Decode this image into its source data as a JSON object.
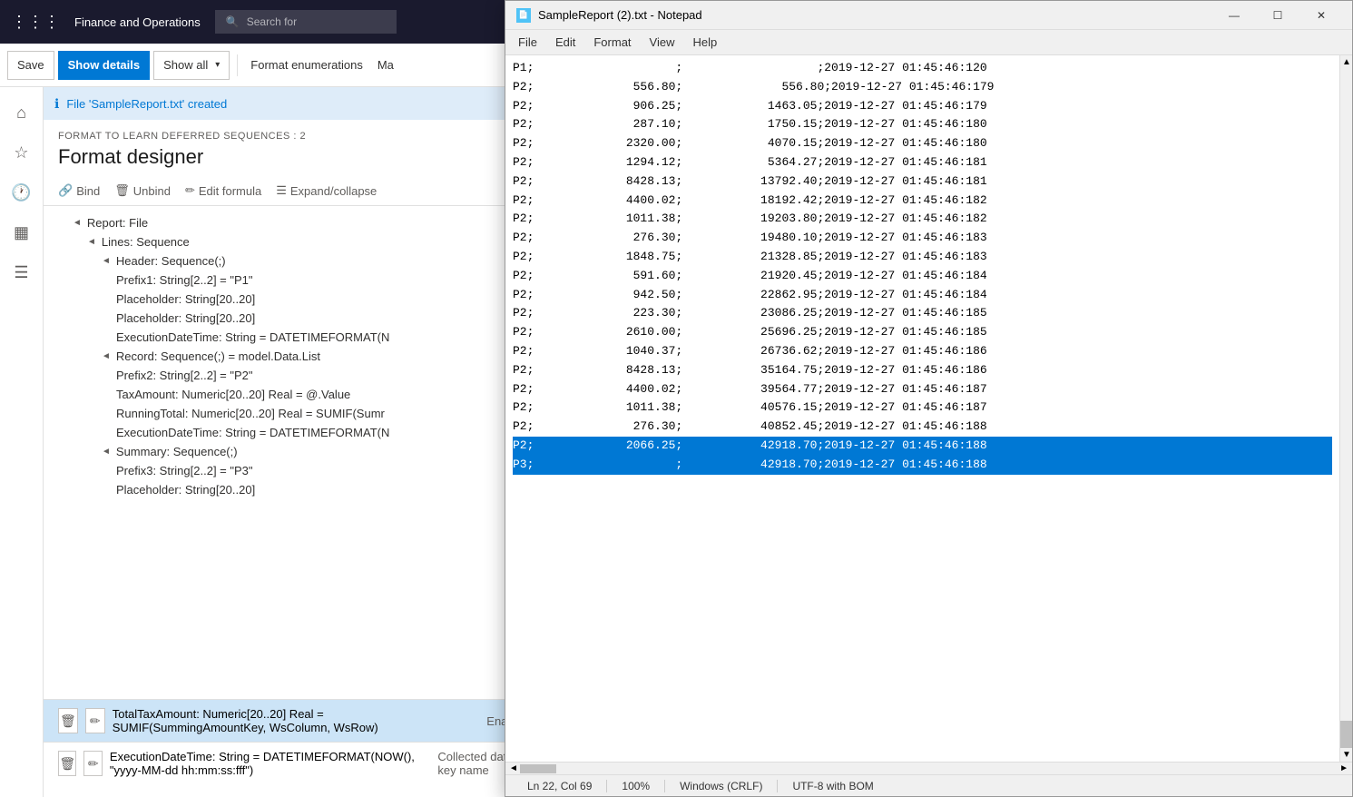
{
  "app": {
    "title": "Finance and Operations",
    "search_placeholder": "Search for"
  },
  "toolbar": {
    "save_label": "Save",
    "show_details_label": "Show details",
    "show_all_label": "Show all",
    "format_enum_label": "Format enumerations",
    "ma_label": "Ma"
  },
  "info_bar": {
    "message": "File 'SampleReport.txt' created"
  },
  "designer": {
    "subtitle": "FORMAT TO LEARN DEFERRED SEQUENCES : 2",
    "title": "Format designer",
    "tools": {
      "bind": "Bind",
      "unbind": "Unbind",
      "edit_formula": "Edit formula",
      "expand_collapse": "Expand/collapse"
    }
  },
  "tree": {
    "items": [
      {
        "label": "Report: File",
        "level": 0,
        "arrow": "◄",
        "indent": "indent1"
      },
      {
        "label": "Lines: Sequence",
        "level": 1,
        "arrow": "◄",
        "indent": "indent2"
      },
      {
        "label": "Header: Sequence(;)",
        "level": 2,
        "arrow": "◄",
        "indent": "indent3"
      },
      {
        "label": "Prefix1: String[2..2] = \"P1\"",
        "level": 3,
        "arrow": "",
        "indent": "indent4"
      },
      {
        "label": "Placeholder: String[20..20]",
        "level": 3,
        "arrow": "",
        "indent": "indent4"
      },
      {
        "label": "Placeholder: String[20..20]",
        "level": 3,
        "arrow": "",
        "indent": "indent4"
      },
      {
        "label": "ExecutionDateTime: String = DATETIMEFORMAT(N",
        "level": 3,
        "arrow": "",
        "indent": "indent4"
      },
      {
        "label": "Record: Sequence(;) = model.Data.List",
        "level": 2,
        "arrow": "◄",
        "indent": "indent3"
      },
      {
        "label": "Prefix2: String[2..2] = \"P2\"",
        "level": 3,
        "arrow": "",
        "indent": "indent4"
      },
      {
        "label": "TaxAmount: Numeric[20..20] Real = @.Value",
        "level": 3,
        "arrow": "",
        "indent": "indent4"
      },
      {
        "label": "RunningTotal: Numeric[20..20] Real = SUMIF(Sumr",
        "level": 3,
        "arrow": "",
        "indent": "indent4"
      },
      {
        "label": "ExecutionDateTime: String = DATETIMEFORMAT(N",
        "level": 3,
        "arrow": "",
        "indent": "indent4"
      },
      {
        "label": "Summary: Sequence(;)",
        "level": 2,
        "arrow": "◄",
        "indent": "indent3"
      },
      {
        "label": "Prefix3: String[2..2] = \"P3\"",
        "level": 3,
        "arrow": "",
        "indent": "indent4"
      },
      {
        "label": "Placeholder: String[20..20]",
        "level": 3,
        "arrow": "",
        "indent": "indent4"
      }
    ]
  },
  "bottom_rows": [
    {
      "label": "TotalTaxAmount: Numeric[20..20] Real = SUMIF(SummingAmountKey, WsColumn, WsRow)",
      "selected": true
    },
    {
      "label": "ExecutionDateTime: String = DATETIMEFORMAT(NOW(), \"yyyy-MM-dd hh:mm:ss:fff\")",
      "selected": false
    }
  ],
  "right_props": [
    {
      "label": "Enabled"
    },
    {
      "label": "Collected data key name"
    }
  ],
  "notepad": {
    "title": "SampleReport (2).txt - Notepad",
    "menu_items": [
      "File",
      "Edit",
      "Format",
      "View",
      "Help"
    ],
    "lines": [
      {
        "text": "P1;                    ;                   ;2019-12-27 01:45:46:120",
        "highlight": false
      },
      {
        "text": "P2;              556.80;              556.80;2019-12-27 01:45:46:179",
        "highlight": false
      },
      {
        "text": "P2;              906.25;            1463.05;2019-12-27 01:45:46:179",
        "highlight": false
      },
      {
        "text": "P2;              287.10;            1750.15;2019-12-27 01:45:46:180",
        "highlight": false
      },
      {
        "text": "P2;             2320.00;            4070.15;2019-12-27 01:45:46:180",
        "highlight": false
      },
      {
        "text": "P2;             1294.12;            5364.27;2019-12-27 01:45:46:181",
        "highlight": false
      },
      {
        "text": "P2;             8428.13;           13792.40;2019-12-27 01:45:46:181",
        "highlight": false
      },
      {
        "text": "P2;             4400.02;           18192.42;2019-12-27 01:45:46:182",
        "highlight": false
      },
      {
        "text": "P2;             1011.38;           19203.80;2019-12-27 01:45:46:182",
        "highlight": false
      },
      {
        "text": "P2;              276.30;           19480.10;2019-12-27 01:45:46:183",
        "highlight": false
      },
      {
        "text": "P2;             1848.75;           21328.85;2019-12-27 01:45:46:183",
        "highlight": false
      },
      {
        "text": "P2;              591.60;           21920.45;2019-12-27 01:45:46:184",
        "highlight": false
      },
      {
        "text": "P2;              942.50;           22862.95;2019-12-27 01:45:46:184",
        "highlight": false
      },
      {
        "text": "P2;              223.30;           23086.25;2019-12-27 01:45:46:185",
        "highlight": false
      },
      {
        "text": "P2;             2610.00;           25696.25;2019-12-27 01:45:46:185",
        "highlight": false
      },
      {
        "text": "P2;             1040.37;           26736.62;2019-12-27 01:45:46:186",
        "highlight": false
      },
      {
        "text": "P2;             8428.13;           35164.75;2019-12-27 01:45:46:186",
        "highlight": false
      },
      {
        "text": "P2;             4400.02;           39564.77;2019-12-27 01:45:46:187",
        "highlight": false
      },
      {
        "text": "P2;             1011.38;           40576.15;2019-12-27 01:45:46:187",
        "highlight": false
      },
      {
        "text": "P2;              276.30;           40852.45;2019-12-27 01:45:46:188",
        "highlight": false
      },
      {
        "text": "P2;             2066.25;           42918.70;2019-12-27 01:45:46:188",
        "highlight": true
      },
      {
        "text": "P3;                    ;           42918.70;2019-12-27 01:45:46:188",
        "highlight": true
      }
    ],
    "statusbar": {
      "position": "Ln 22, Col 69",
      "zoom": "100%",
      "line_ending": "Windows (CRLF)",
      "encoding": "UTF-8 with BOM"
    }
  }
}
